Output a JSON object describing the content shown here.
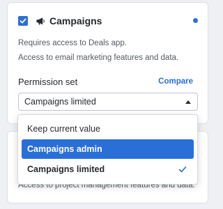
{
  "permission": {
    "title": "Campaigns",
    "checked": true,
    "icon": "megaphone-icon",
    "requirement_text": "Requires access to Deals app.",
    "description": "Access to email marketing features and data.",
    "permission_set_label": "Permission set",
    "compare_label": "Compare",
    "selected_value": "Campaigns limited"
  },
  "dropdown": {
    "options": [
      {
        "label": "Keep current value",
        "highlighted": false,
        "selected": false
      },
      {
        "label": "Campaigns admin",
        "highlighted": true,
        "selected": false
      },
      {
        "label": "Campaigns limited",
        "highlighted": false,
        "selected": true
      }
    ]
  },
  "next_card": {
    "description": "Access to project management features and data."
  },
  "colors": {
    "accent": "#2a6fd8",
    "text": "#26292e",
    "muted_text": "#555a62"
  }
}
